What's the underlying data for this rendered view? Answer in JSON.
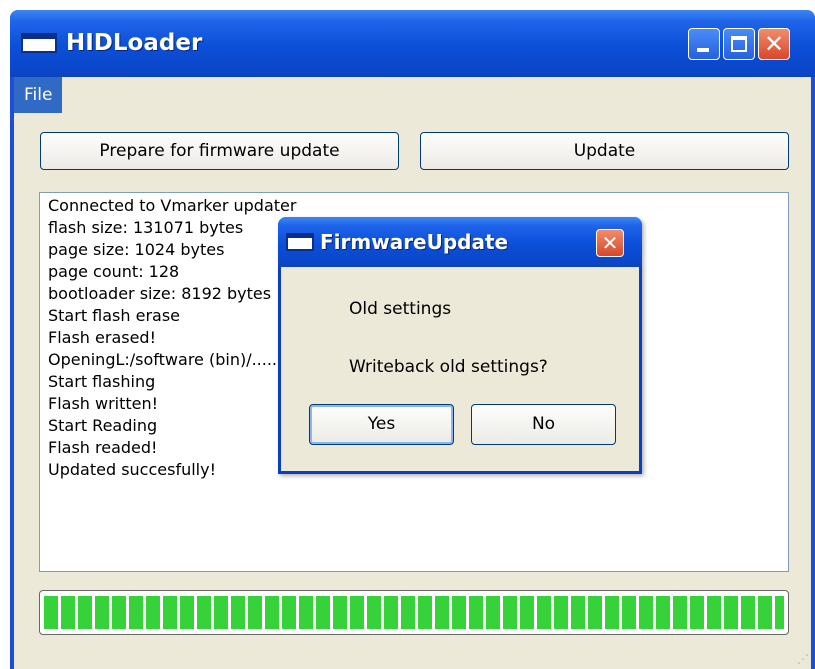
{
  "window": {
    "title": "HIDLoader",
    "menu": [
      "File"
    ],
    "buttons": {
      "prepare": "Prepare for firmware update",
      "update": "Update"
    },
    "log": [
      "Connected to Vmarker updater",
      "flash size: 131071 bytes",
      "page size: 1024 bytes",
      "page count: 128",
      "bootloader size: 8192 bytes",
      "Start flash erase",
      "Flash erased!",
      "OpeningL:/software (bin)/....................................02.bin",
      "Start flashing",
      "Flash written!",
      "Start Reading",
      "Flash readed!",
      "Updated succesfully!"
    ],
    "progress_fraction": 1.0,
    "progress_color": "#37d23a"
  },
  "dialog": {
    "title": "FirmwareUpdate",
    "heading": "Old settings",
    "question": "Writeback old settings?",
    "yes_label": "Yes",
    "no_label": "No"
  },
  "icons": {
    "minimize": "minimize-icon",
    "maximize": "maximize-icon",
    "close": "close-icon"
  }
}
